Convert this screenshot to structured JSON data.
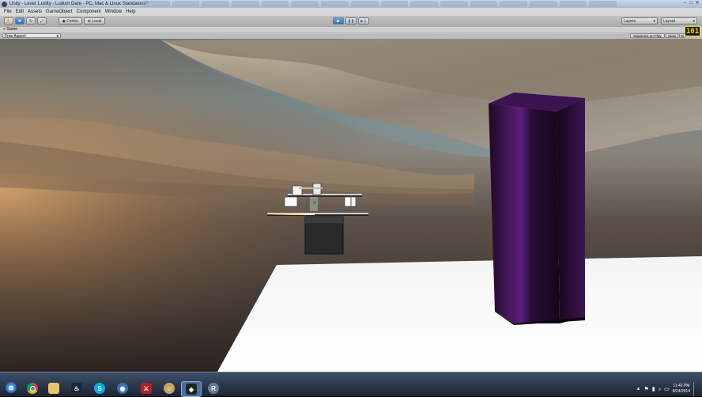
{
  "window": {
    "title": "Unity - Level 1.unity - Ludum Dare - PC, Mac & Linux Standalone*",
    "controls": [
      "–",
      "□",
      "✕"
    ]
  },
  "menubar": {
    "items": [
      "File",
      "Edit",
      "Assets",
      "GameObject",
      "Component",
      "Window",
      "Help"
    ]
  },
  "toolbar": {
    "pivot_label": "Center",
    "space_label": "Local",
    "layers_label": "Layers",
    "layout_label": "Layout",
    "accent": "#2f6ecc"
  },
  "game_view": {
    "tab_label": "Game",
    "aspect_label": "Free Aspect",
    "maximize_label": "Maximize on Play",
    "stats_label": "Stats",
    "gizmos_label": "Gi",
    "fps_badge": "101"
  },
  "taskbar": {
    "apps": [
      "start-orb",
      "chrome-icon",
      "explorer-icon",
      "steam-icon",
      "skype-icon",
      "media-icon",
      "game-icon",
      "monkey-icon",
      "unity-icon",
      "resharper-icon"
    ],
    "time": "11:42 PM",
    "date": "8/24/2014",
    "colors": {
      "bar": "#1b2534",
      "unity_active": "#4b6f9f"
    }
  }
}
